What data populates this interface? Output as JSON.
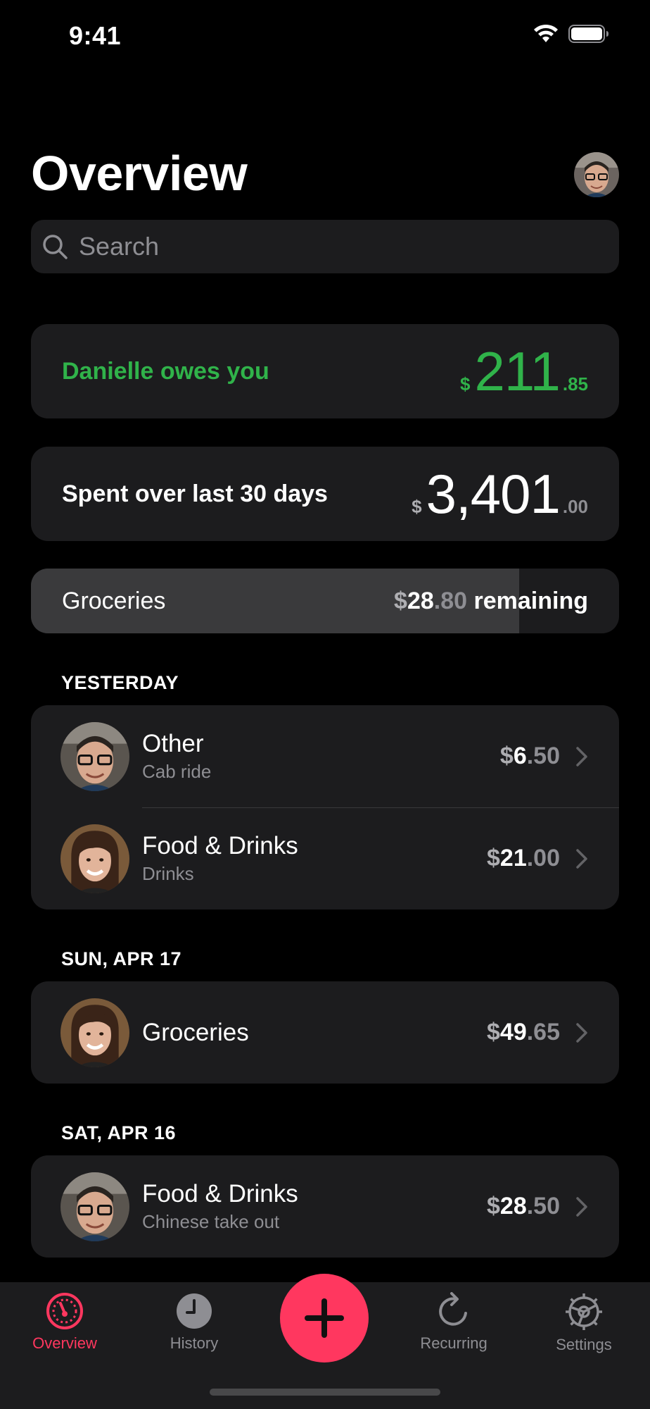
{
  "status_bar": {
    "time": "9:41"
  },
  "header": {
    "title": "Overview"
  },
  "search": {
    "placeholder": "Search"
  },
  "owes_card": {
    "label": "Danielle owes you",
    "currency": "$",
    "amount_int": "211",
    "amount_dec": ".85",
    "color": "#30b34a"
  },
  "spent_card": {
    "label": "Spent over last 30 days",
    "currency": "$",
    "amount_int": "3,401",
    "amount_dec": ".00"
  },
  "budget": {
    "label": "Groceries",
    "currency": "$",
    "remaining_int": "28",
    "remaining_dec": ".80",
    "remaining_suffix": " remaining",
    "progress_fraction": 0.83
  },
  "sections": [
    {
      "header": "YESTERDAY",
      "items": [
        {
          "title": "Other",
          "subtitle": "Cab ride",
          "currency": "$",
          "amount_int": "6",
          "amount_dec": ".50",
          "avatar": "man-glasses"
        },
        {
          "title": "Food & Drinks",
          "subtitle": "Drinks",
          "currency": "$",
          "amount_int": "21",
          "amount_dec": ".00",
          "avatar": "woman"
        }
      ]
    },
    {
      "header": "SUN, APR 17",
      "items": [
        {
          "title": "Groceries",
          "subtitle": "",
          "currency": "$",
          "amount_int": "49",
          "amount_dec": ".65",
          "avatar": "woman"
        }
      ]
    },
    {
      "header": "SAT, APR 16",
      "items": [
        {
          "title": "Food & Drinks",
          "subtitle": "Chinese take out",
          "currency": "$",
          "amount_int": "28",
          "amount_dec": ".50",
          "avatar": "man-glasses"
        }
      ]
    }
  ],
  "tabs": [
    {
      "label": "Overview",
      "icon": "gauge-icon",
      "active": true
    },
    {
      "label": "History",
      "icon": "clock-icon",
      "active": false
    },
    {
      "label": "Recurring",
      "icon": "repeat-icon",
      "active": false
    },
    {
      "label": "Settings",
      "icon": "gear-icon",
      "active": false
    }
  ],
  "colors": {
    "accent": "#ff375f",
    "positive": "#30b34a",
    "card": "#1c1c1e"
  }
}
